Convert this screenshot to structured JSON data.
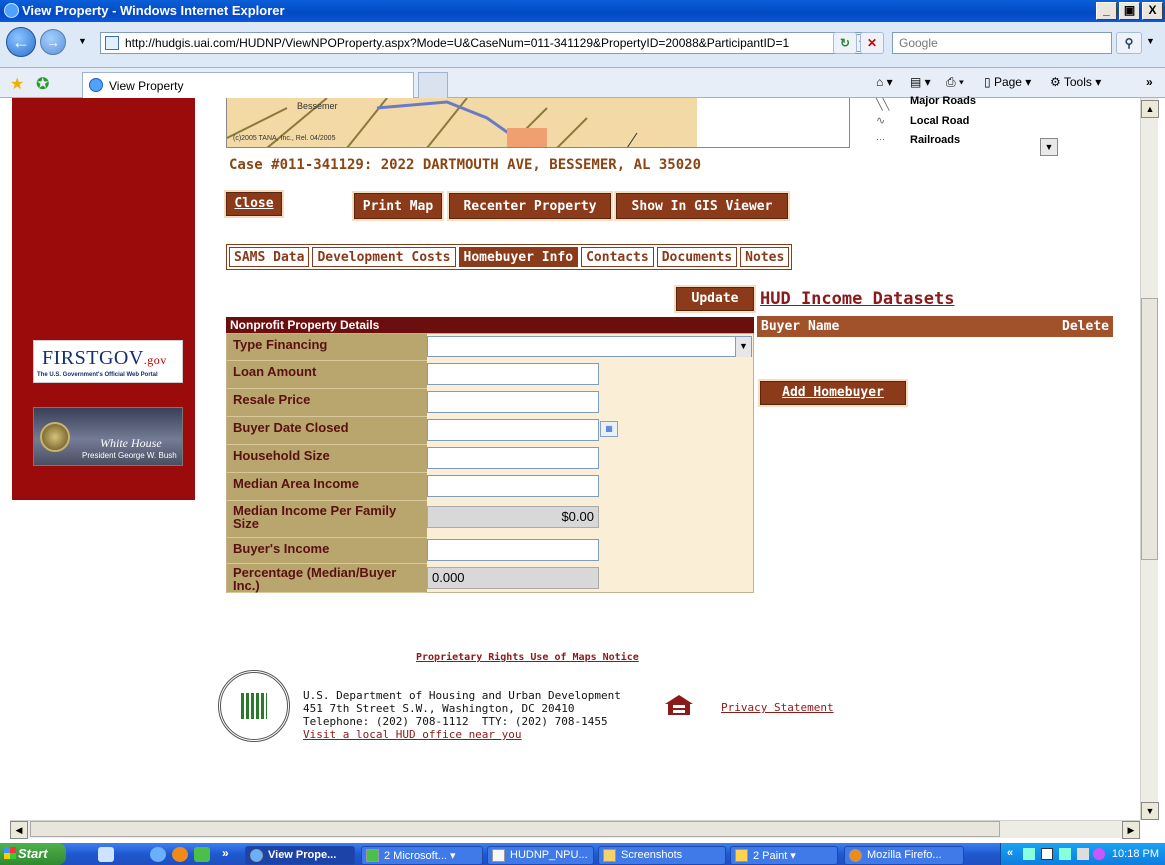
{
  "window": {
    "title": "View Property - Windows Internet Explorer",
    "min": "_",
    "max": " ",
    "close": "X"
  },
  "browser": {
    "url": "http://hudgis.uai.com/HUDNP/ViewNPOProperty.aspx?Mode=U&CaseNum=011-341129&PropertyID=20088&ParticipantID=1",
    "search_placeholder": "Google",
    "tab_title": "View Property",
    "page_menu": "Page",
    "tools_menu": "Tools"
  },
  "sidebar": {
    "firstgov_brand": "FIRSTGOV",
    "firstgov_tld": ".gov",
    "firstgov_tagline": "The U.S. Government's Official Web Portal",
    "whitehouse_title": "White House",
    "whitehouse_subtitle": "President George W. Bush"
  },
  "map": {
    "copyright": "(c)2005 TANA, Inc., Rel. 04/2005",
    "place_label": "Bessemer"
  },
  "legend": [
    {
      "label": "Major Roads"
    },
    {
      "label": "Local Road"
    },
    {
      "label": "Railroads"
    }
  ],
  "case_heading": "Case #011-341129: 2022 DARTMOUTH AVE, BESSEMER, AL 35020",
  "actions": {
    "close": "Close",
    "print_map": "Print Map",
    "recenter": "Recenter Property",
    "gis": "Show In GIS Viewer"
  },
  "tabs": [
    {
      "label": "SAMS Data",
      "active": false
    },
    {
      "label": "Development Costs",
      "active": false
    },
    {
      "label": "Homebuyer Info",
      "active": true
    },
    {
      "label": "Contacts",
      "active": false
    },
    {
      "label": "Documents",
      "active": false
    },
    {
      "label": "Notes",
      "active": false
    }
  ],
  "update_button": "Update",
  "hud_datasets_link": "HUD Income Datasets",
  "form": {
    "header": "Nonprofit Property Details",
    "fields": [
      {
        "label": "Type Financing",
        "value": ""
      },
      {
        "label": "Loan Amount",
        "value": ""
      },
      {
        "label": "Resale Price",
        "value": ""
      },
      {
        "label": "Buyer Date Closed",
        "value": ""
      },
      {
        "label": "Household Size",
        "value": ""
      },
      {
        "label": "Median Area Income",
        "value": ""
      },
      {
        "label": "Median Income Per Family Size",
        "value": "$0.00"
      },
      {
        "label": "Buyer's Income",
        "value": ""
      },
      {
        "label": "Percentage (Median/Buyer Inc.)",
        "value": "0.000"
      }
    ]
  },
  "buyers": {
    "col_name": "Buyer Name",
    "col_delete": "Delete",
    "add_button": "Add Homebuyer"
  },
  "footer": {
    "notice": "Proprietary Rights Use of Maps Notice",
    "address": "U.S. Department of Housing and Urban Development\n451 7th Street S.W., Washington, DC 20410\nTelephone: (202) 708-1112  TTY: (202) 708-1455",
    "local_office": "Visit a local HUD office near you",
    "privacy": "Privacy Statement"
  },
  "taskbar": {
    "start": "Start",
    "tasks": [
      {
        "label": "View Prope...",
        "active": true
      },
      {
        "label": "2 Microsoft...",
        "active": false
      },
      {
        "label": "HUDNP_NPU...",
        "active": false
      },
      {
        "label": "Screenshots",
        "active": false
      },
      {
        "label": "2 Paint",
        "active": false
      },
      {
        "label": "Mozilla Firefo...",
        "active": false
      }
    ],
    "clock": "10:18 PM"
  }
}
